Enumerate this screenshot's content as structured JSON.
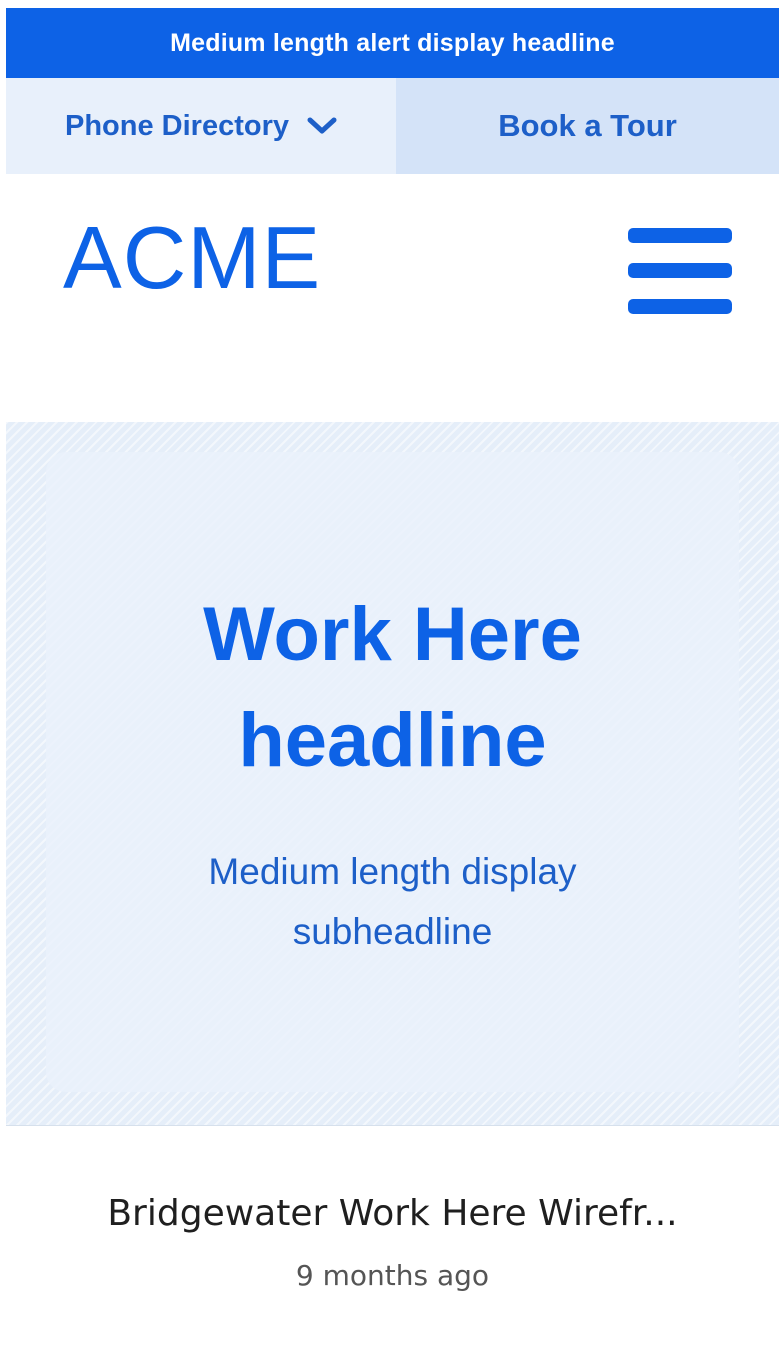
{
  "colors": {
    "brand_blue": "#0d62e6",
    "link_blue": "#1d5fc8",
    "utility_left_bg": "#e8f0fb",
    "utility_right_bg": "#d4e3f8",
    "hero_bg": "#e5eef9"
  },
  "alert": {
    "headline": "Medium length alert display headline"
  },
  "utility_nav": {
    "phone_directory_label": "Phone Directory",
    "phone_directory_icon": "chevron-down-icon",
    "book_tour_label": "Book a Tour"
  },
  "header": {
    "logo_text": "ACME",
    "menu_icon": "hamburger-menu-icon"
  },
  "hero": {
    "title_line1": "Work Here",
    "title_line2": "headline",
    "subtitle_line1": "Medium length display",
    "subtitle_line2": "subheadline"
  },
  "card": {
    "title": "Bridgewater Work Here Wirefr...",
    "time": "9 months ago"
  }
}
